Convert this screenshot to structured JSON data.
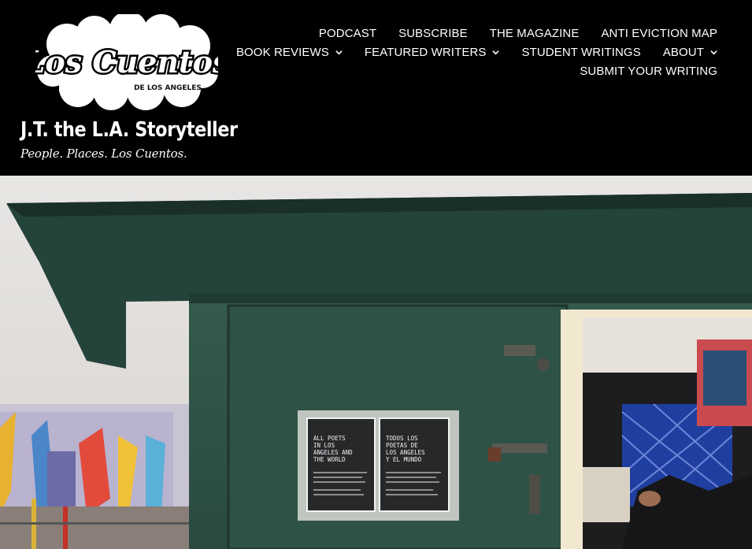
{
  "site": {
    "logo_text": "Los Cuentos",
    "logo_subtext": "DE LOS ANGELES",
    "title": "J.T. the L.A. Storyteller",
    "tagline": "People. Places. Los Cuentos."
  },
  "nav": {
    "row1": [
      {
        "label": "PODCAST"
      },
      {
        "label": "SUBSCRIBE"
      },
      {
        "label": "THE MAGAZINE"
      },
      {
        "label": "ANTI EVICTION MAP"
      }
    ],
    "row2": [
      {
        "label": "BOOK REVIEWS",
        "has_dropdown": true
      },
      {
        "label": "FEATURED WRITERS",
        "has_dropdown": true
      },
      {
        "label": "STUDENT WRITINGS"
      },
      {
        "label": "ABOUT",
        "has_dropdown": true
      }
    ],
    "row3": [
      {
        "label": "SUBMIT YOUR WRITING"
      }
    ]
  },
  "hero": {
    "poster_left_title": "ALL POETS IN LOS ANGELES AND THE WORLD",
    "poster_right_title": "TODOS LOS POETAS DE LOS ANGELES Y EL MUNDO"
  },
  "colors": {
    "header_bg": "#000000",
    "kiosk_green": "#2e4f44",
    "text": "#ffffff"
  }
}
